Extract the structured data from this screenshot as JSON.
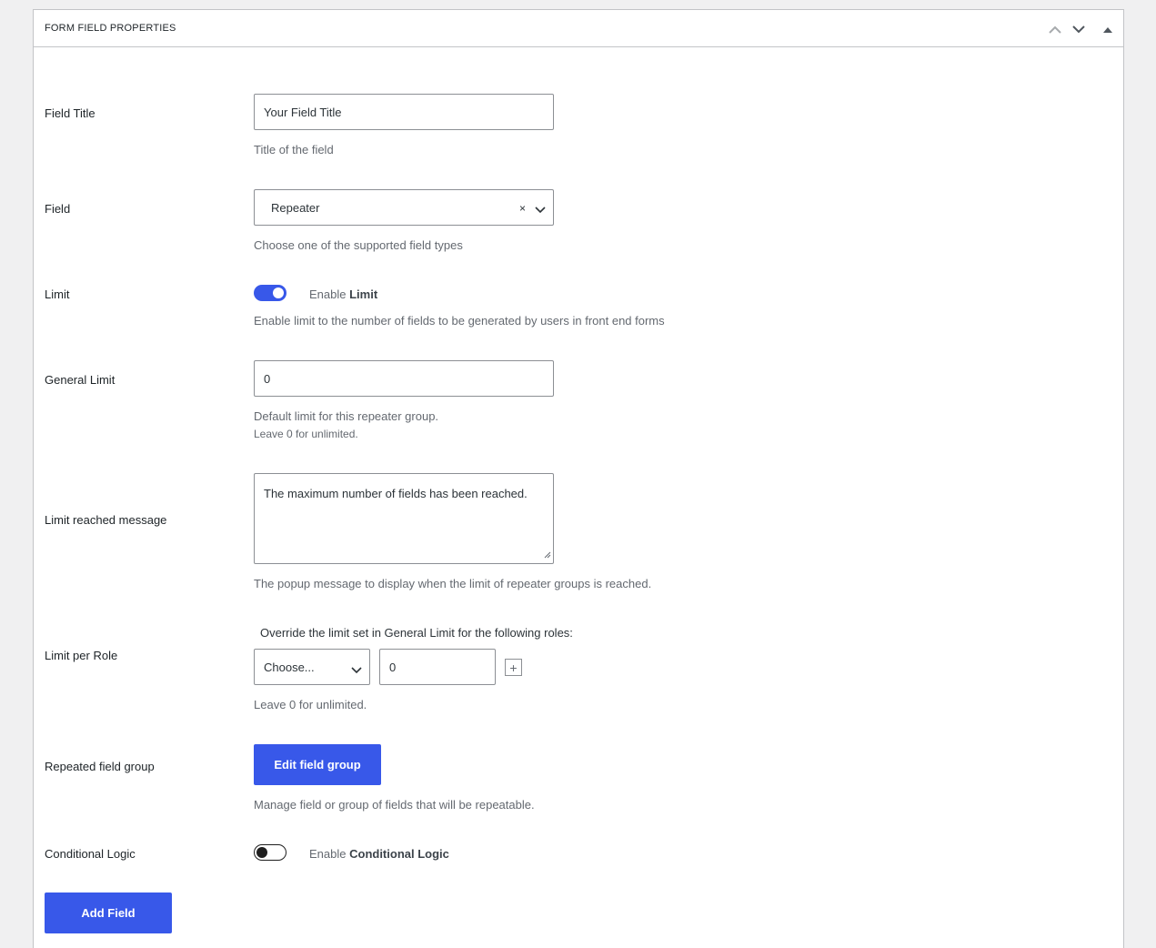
{
  "panel": {
    "title": "FORM FIELD PROPERTIES",
    "icons": [
      "chevron-up-icon",
      "chevron-down-icon",
      "triangle-up-icon"
    ]
  },
  "fields": {
    "field_title": {
      "label": "Field Title",
      "value": "Your Field Title",
      "description": "Title of the field"
    },
    "field": {
      "label": "Field",
      "value": "Repeater",
      "clear_glyph": "×",
      "description": "Choose one of the supported field types"
    },
    "limit": {
      "label": "Limit",
      "toggle_state": "on",
      "toggle_prefix": "Enable",
      "toggle_bold": "Limit",
      "description": "Enable limit to the number of fields to be generated by users in front end forms"
    },
    "general_limit": {
      "label": "General Limit",
      "value": "0",
      "description": "Default limit for this repeater group.",
      "note": "Leave 0 for unlimited."
    },
    "limit_message": {
      "label": "Limit reached message",
      "value": "The maximum number of fields has been reached.",
      "description": "The popup message to display when the limit of repeater groups is reached."
    },
    "limit_per_role": {
      "label": "Limit per Role",
      "intro": "Override the limit set in General Limit for the following roles:",
      "select_value": "Choose...",
      "number_value": "0",
      "plus_glyph": "+",
      "note": "Leave 0 for unlimited."
    },
    "repeated_group": {
      "label": "Repeated field group",
      "button": "Edit field group",
      "description": "Manage field or group of fields that will be repeatable."
    },
    "conditional_logic": {
      "label": "Conditional Logic",
      "toggle_state": "off",
      "toggle_prefix": "Enable",
      "toggle_bold": "Conditional Logic"
    }
  },
  "actions": {
    "add_field": "Add Field"
  },
  "colors": {
    "accent": "#3858e9",
    "border": "#c3c4c7",
    "background": "#f0f0f1"
  }
}
